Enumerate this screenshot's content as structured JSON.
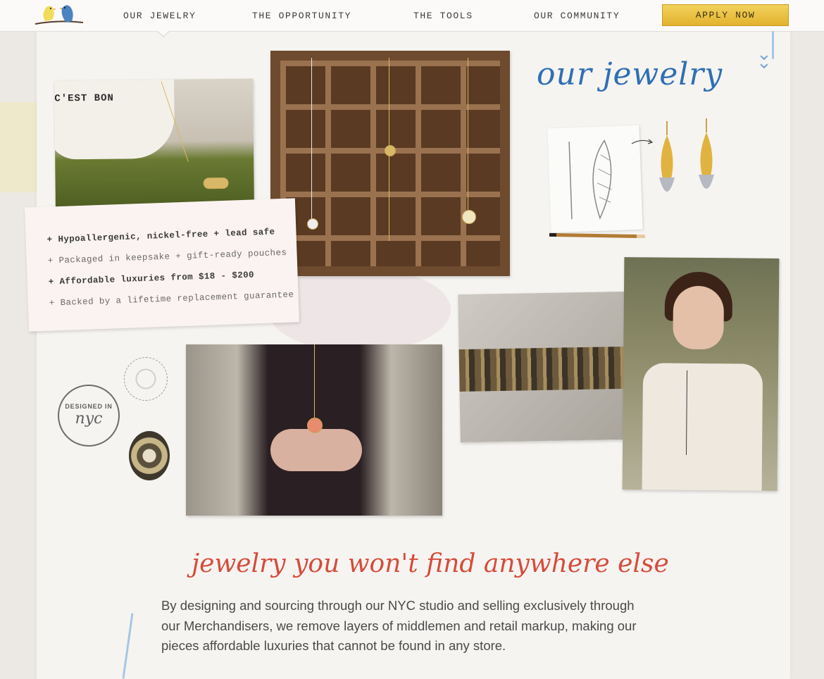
{
  "nav": {
    "items": [
      {
        "label": "OUR JEWELRY"
      },
      {
        "label": "THE OPPORTUNITY"
      },
      {
        "label": "THE TOOLS"
      },
      {
        "label": "OUR COMMUNITY"
      }
    ],
    "apply_label": "APPLY NOW",
    "logo_icon": "two-birds-on-branch-icon"
  },
  "hero": {
    "title": "our jewelry",
    "mug_text": "C'EST BON"
  },
  "features": [
    "+ Hypoallergenic, nickel-free + lead safe",
    "+ Packaged in keepsake + gift-ready pouches",
    "+ Affordable luxuries from $18 - $200",
    "+ Backed by a lifetime replacement guarantee"
  ],
  "stamp": {
    "top": "DESIGNED IN",
    "bottom": "nyc"
  },
  "section": {
    "heading": "jewelry you won't find anywhere else",
    "body": "By designing and sourcing through our NYC studio and selling exclusively through our Merchandisers, we remove layers of middlemen and retail markup, making our pieces affordable luxuries that cannot be found in any store."
  },
  "colors": {
    "title_blue": "#2f6fb4",
    "heading_red": "#d54c3a",
    "apply_gold": "#e9c24a"
  }
}
